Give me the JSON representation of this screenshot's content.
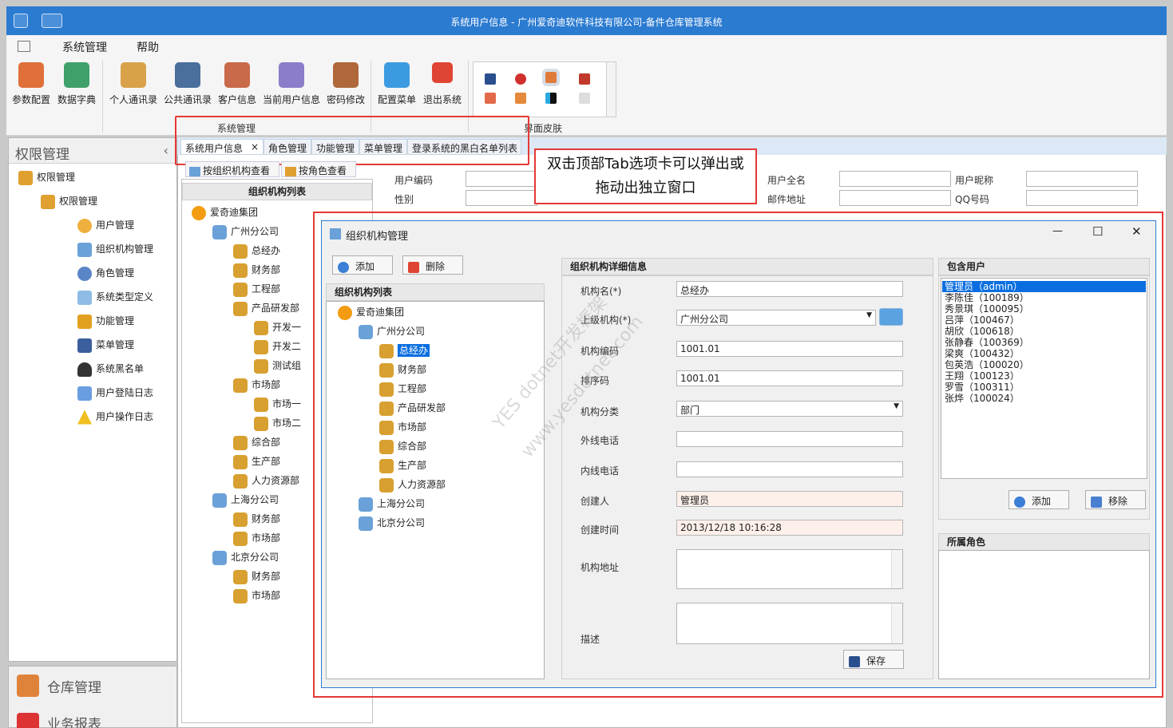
{
  "app": {
    "title": "系统用户信息 - 广州爱奇迪软件科技有限公司-备件仓库管理系统"
  },
  "menu": [
    "系统管理",
    "帮助"
  ],
  "ribbon": {
    "buttons": [
      "参数配置",
      "数据字典",
      "个人通讯录",
      "公共通讯录",
      "客户信息",
      "当前用户信息",
      "密码修改",
      "配置菜单",
      "退出系统"
    ],
    "group_system": "系统管理",
    "group_skin": "界面皮肤"
  },
  "left": {
    "title": "权限管理",
    "collapse": "‹",
    "tree": [
      "权限管理",
      "权限管理",
      "用户管理",
      "组织机构管理",
      "角色管理",
      "系统类型定义",
      "功能管理",
      "菜单管理",
      "系统黑名单",
      "用户登陆日志",
      "用户操作日志"
    ],
    "accordion": [
      "仓库管理",
      "业务报表"
    ]
  },
  "tabs": {
    "items": [
      "系统用户信息",
      "角色管理",
      "功能管理",
      "菜单管理",
      "登录系统的黑白名单列表"
    ],
    "close": "×"
  },
  "callout": {
    "line1": "双击顶部Tab选项卡可以弹出或",
    "line2": "拖动出独立窗口"
  },
  "user_form": {
    "subtabs": [
      "按组织机构查看",
      "按角色查看"
    ],
    "org_list_title": "组织机构列表",
    "labels": [
      "用户编码",
      "性别",
      "用户全名",
      "邮件地址",
      "用户昵称",
      "QQ号码"
    ]
  },
  "bg_tree": [
    "爱奇迪集团",
    "广州分公司",
    "总经办",
    "财务部",
    "工程部",
    "产品研发部",
    "开发一",
    "开发二",
    "测试组",
    "市场部",
    "市场一",
    "市场二",
    "综合部",
    "生产部",
    "人力资源部",
    "上海分公司",
    "财务部",
    "市场部",
    "北京分公司",
    "财务部",
    "市场部"
  ],
  "dialog": {
    "title": "组织机构管理",
    "controls": {
      "min": "—",
      "max": "☐",
      "close": "✕"
    },
    "add": "添加",
    "delete": "删除",
    "list_title": "组织机构列表",
    "tree": [
      "爱奇迪集团",
      "广州分公司",
      "总经办",
      "财务部",
      "工程部",
      "产品研发部",
      "市场部",
      "综合部",
      "生产部",
      "人力资源部",
      "上海分公司",
      "北京分公司"
    ],
    "detail_title": "组织机构详细信息",
    "fields": {
      "name_label": "机构名(*)",
      "name": "总经办",
      "parent_label": "上级机构(*)",
      "parent": "广州分公司",
      "code_label": "机构编码",
      "code": "1001.01",
      "sort_label": "排序码",
      "sort": "1001.01",
      "category_label": "机构分类",
      "category": "部门",
      "outer_phone_label": "外线电话",
      "outer_phone": "",
      "inner_phone_label": "内线电话",
      "inner_phone": "",
      "creator_label": "创建人",
      "creator": "管理员",
      "created_label": "创建时间",
      "created": "2013/12/18 10:16:28",
      "address_label": "机构地址",
      "desc_label": "描述"
    },
    "save": "保存",
    "users_title": "包含用户",
    "users": [
      "管理员（admin）",
      "李陈佳（100189）",
      "秀景琪（100095）",
      "吕萍（100467）",
      "胡欣（100618）",
      "张静春（100369）",
      "梁爽（100432）",
      "包英浩（100020）",
      "王翔（100123）",
      "罗雪（100311）",
      "张烨（100024）"
    ],
    "user_add": "添加",
    "user_remove": "移除",
    "roles_title": "所属角色"
  },
  "watermark": [
    "YES dotnet开发框架",
    "www.yesdotnet.com"
  ],
  "colors": {
    "accent": "#2b7bd1",
    "highlight": "#e53935",
    "selected": "#0a6ee0"
  }
}
